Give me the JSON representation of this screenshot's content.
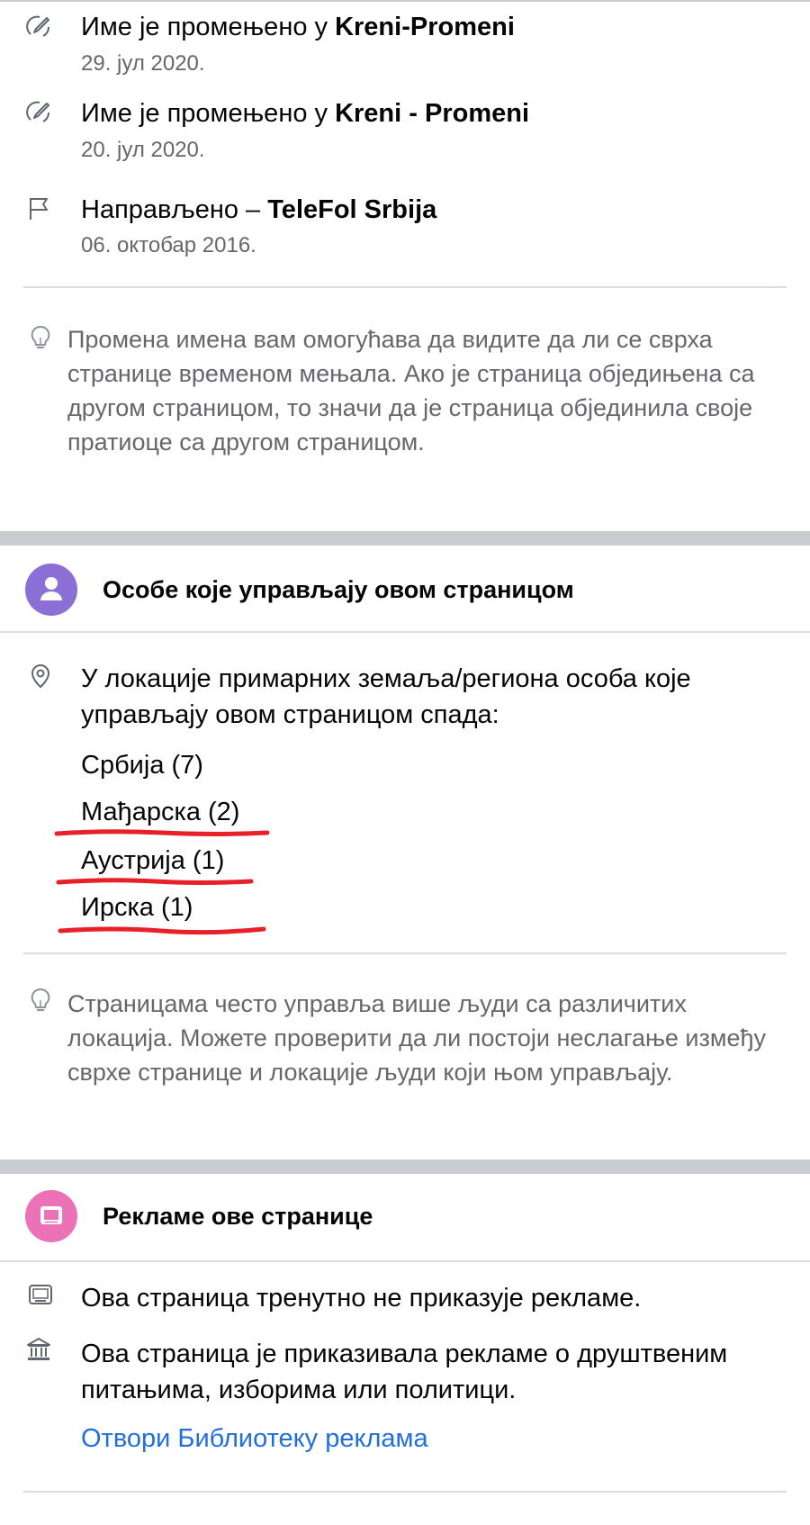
{
  "history": [
    {
      "prefix": "Име је промењено у",
      "name": "Kreni-Promeni",
      "date": "29. јул 2020.",
      "icon": "rename-icon"
    },
    {
      "prefix": "Име је промењено у",
      "name": "Kreni - Promeni",
      "date": "20. јул 2020.",
      "icon": "rename-icon"
    },
    {
      "prefix": "Направљено –",
      "name": "TeleFol Srbija",
      "date": "06. октобар 2016.",
      "icon": "flag-icon"
    }
  ],
  "history_tip": "Промена имена вам омогућава да видите да ли се сврха странице временом мењала. Ако је страница обједињена са другом страницом, то значи да је страница објединила своје пратиоце са другом страницом.",
  "managers": {
    "title": "Особе које управљају овом страницом",
    "intro": "У локације примарних земаља/региона особа које управљају овом страницом спада:",
    "countries": [
      "Србија (7)",
      "Мађарска (2)",
      "Аустрија (1)",
      "Ирска (1)"
    ],
    "tip": "Страницама често управља више људи са различитих локација. Можете проверити да ли постоји неслагање између сврхе странице и локације људи који њом управљају."
  },
  "ads": {
    "title": "Рекламе ове странице",
    "current": "Ова страница тренутно не приказује рекламе.",
    "political": "Ова страница је приказивала рекламе о друштвеним питањима, изборима или политици.",
    "library_link": "Отвори Библиотеку реклама"
  },
  "colors": {
    "accent_purple": "#8c6fd6",
    "accent_pink": "#ec72b8",
    "link_blue": "#216fdb",
    "annotation_red": "#e8202a"
  }
}
